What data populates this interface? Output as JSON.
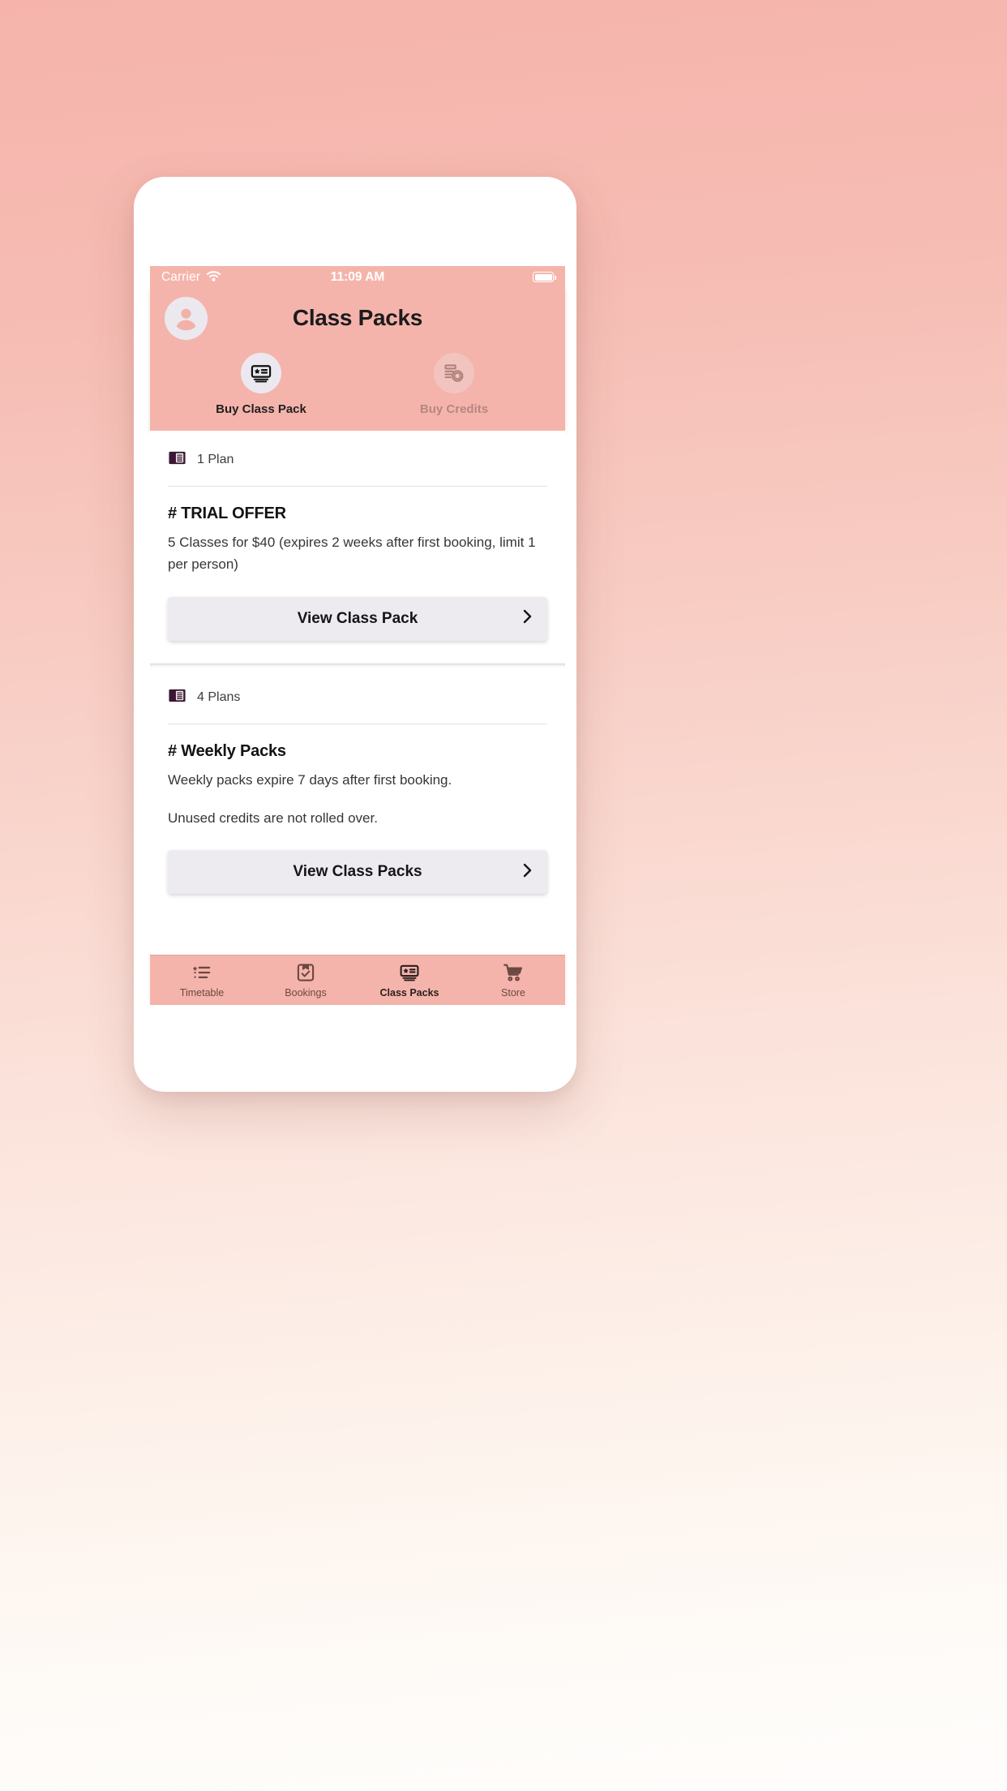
{
  "theme": {
    "accent": "#f5b4ab",
    "icon_chip_bg": "#ebe9ef",
    "plan_icon_color": "#3b1733",
    "button_bg": "#edeaf0",
    "tab_inactive": "#6b4843",
    "tab_active": "#2a1f1d"
  },
  "status_bar": {
    "carrier": "Carrier",
    "wifi_icon": "wifi-icon",
    "time": "11:09 AM",
    "battery_icon": "battery-full-icon"
  },
  "header": {
    "avatar_icon": "user-avatar-icon",
    "title": "Class Packs",
    "actions": [
      {
        "icon": "class-pack-card-icon",
        "label": "Buy Class Pack",
        "enabled": true
      },
      {
        "icon": "credits-money-icon",
        "label": "Buy Credits",
        "enabled": false
      }
    ]
  },
  "sections": [
    {
      "plan_icon": "plan-book-icon",
      "plan_count": "1 Plan",
      "title": "# TRIAL OFFER",
      "paragraphs": [
        "5 Classes for $40 (expires 2 weeks after first booking, limit 1 per person)"
      ],
      "button_label": "View Class Pack",
      "button_chevron": "chevron-right-icon"
    },
    {
      "plan_icon": "plan-book-icon",
      "plan_count": "4 Plans",
      "title": "# Weekly Packs",
      "paragraphs": [
        "Weekly packs expire 7 days after first booking.",
        "Unused credits are not rolled over."
      ],
      "button_label": "View Class Packs",
      "button_chevron": "chevron-right-icon"
    }
  ],
  "tabs": [
    {
      "icon": "timetable-list-icon",
      "label": "Timetable",
      "active": false
    },
    {
      "icon": "bookings-clipboard-check-icon",
      "label": "Bookings",
      "active": false
    },
    {
      "icon": "class-packs-card-icon",
      "label": "Class Packs",
      "active": true
    },
    {
      "icon": "store-cart-icon",
      "label": "Store",
      "active": false
    }
  ]
}
